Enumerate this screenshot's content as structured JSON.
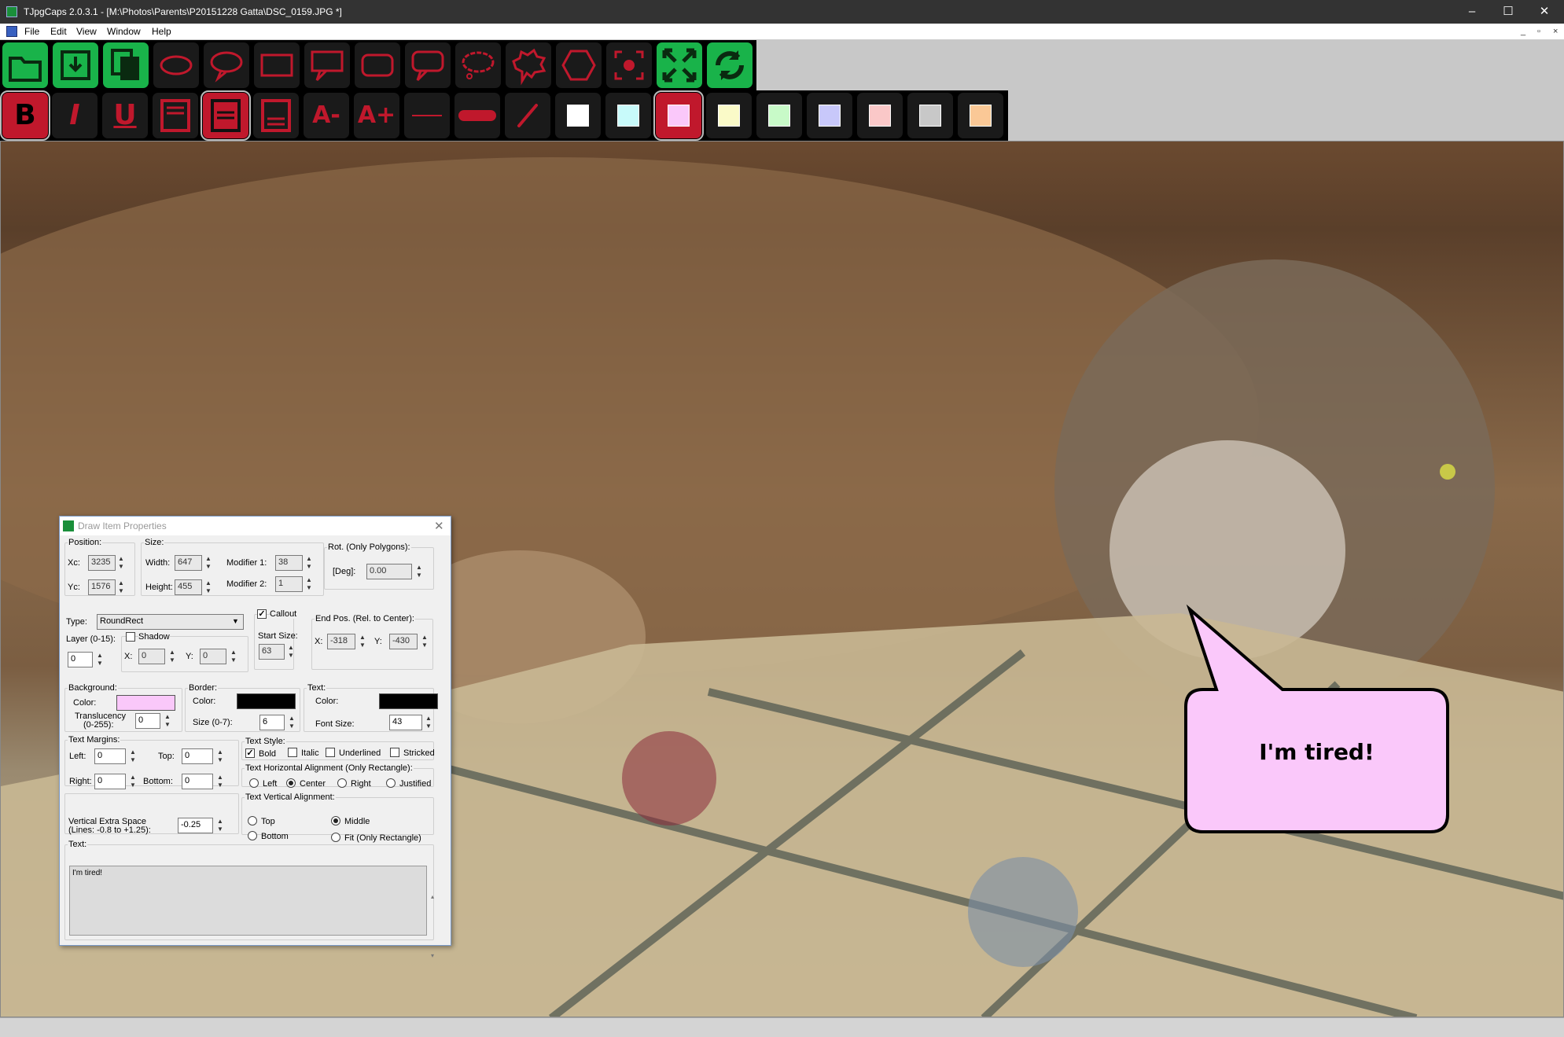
{
  "window": {
    "title": "TJpgCaps 2.0.3.1 - [M:\\Photos\\Parents\\P20151228 Gatta\\DSC_0159.JPG *]",
    "minimize": "–",
    "maximize": "☐",
    "close": "✕"
  },
  "menu": [
    "File",
    "Edit",
    "View",
    "Window",
    "Help"
  ],
  "mdi_controls": [
    "_",
    "▫",
    "×"
  ],
  "toolbar1": [
    {
      "icon": "open-folder-icon",
      "color": "#19b34a"
    },
    {
      "icon": "save-icon",
      "color": "#19b34a"
    },
    {
      "icon": "copy-icon",
      "color": "#19b34a"
    },
    {
      "icon": "ellipse-icon",
      "color": "#c0182c"
    },
    {
      "icon": "ellipse-callout-icon",
      "color": "#c0182c"
    },
    {
      "icon": "rectangle-icon",
      "color": "#c0182c"
    },
    {
      "icon": "rect-callout-icon",
      "color": "#c0182c"
    },
    {
      "icon": "roundrect-icon",
      "color": "#c0182c"
    },
    {
      "icon": "roundrect-callout-icon",
      "color": "#c0182c"
    },
    {
      "icon": "cloud-callout-icon",
      "color": "#c0182c"
    },
    {
      "icon": "spiky-callout-icon",
      "color": "#c0182c"
    },
    {
      "icon": "hexagon-icon",
      "color": "#c0182c"
    },
    {
      "icon": "focus-icon",
      "color": "#c0182c"
    },
    {
      "icon": "fit-screen-icon",
      "color": "#19b34a"
    },
    {
      "icon": "refresh-icon",
      "color": "#19b34a"
    }
  ],
  "toolbar2": {
    "style_buttons": [
      {
        "label": "B",
        "icon": "bold-icon"
      },
      {
        "label": "I",
        "icon": "italic-icon"
      },
      {
        "label": "U",
        "icon": "underline-icon"
      }
    ],
    "align_icons": [
      "align-top-icon",
      "align-middle-icon",
      "align-bottom-icon"
    ],
    "font_minus": "A-",
    "font_plus": "A+",
    "line_icons": [
      "thin-line-icon",
      "thick-line-icon",
      "pen-icon"
    ],
    "swatches": [
      "#ffffff",
      "#c8fafa",
      "#fac8fa",
      "#fafac8",
      "#c8fac8",
      "#c8c8fa",
      "#fac8c8",
      "#c8c8c8",
      "#fac896"
    ],
    "selected_swatch": 2
  },
  "callout": {
    "text": "I'm tired!",
    "bg": "#fac8fa"
  },
  "dialog": {
    "title": "Draw Item Properties",
    "position": {
      "legend": "Position:",
      "xc_label": "Xc:",
      "xc": "3235",
      "yc_label": "Yc:",
      "yc": "1576"
    },
    "size": {
      "legend": "Size:",
      "width_label": "Width:",
      "width": "647",
      "height_label": "Height:",
      "height": "455",
      "mod1_label": "Modifier 1:",
      "mod1": "38",
      "mod2_label": "Modifier 2:",
      "mod2": "1"
    },
    "rot": {
      "legend": "Rot. (Only Polygons):",
      "deg_label": "[Deg]:",
      "deg": "0.00"
    },
    "type_label": "Type:",
    "type": "RoundRect",
    "layer_label": "Layer (0-15):",
    "layer": "0",
    "shadow": {
      "label": "Shadow",
      "x_label": "X:",
      "x": "0",
      "y_label": "Y:",
      "y": "0"
    },
    "callout": {
      "label": "Callout",
      "start_label": "Start Size:",
      "start": "63"
    },
    "endpos": {
      "legend": "End Pos. (Rel. to Center):",
      "x_label": "X:",
      "x": "-318",
      "y_label": "Y:",
      "y": "-430"
    },
    "background": {
      "legend": "Background:",
      "color_label": "Color:",
      "color": "#fac8fa",
      "trans_label1": "Translucency",
      "trans_label2": "(0-255):",
      "trans": "0"
    },
    "border": {
      "legend": "Border:",
      "color_label": "Color:",
      "color": "#000000",
      "size_label": "Size (0-7):",
      "size": "6"
    },
    "text": {
      "legend": "Text:",
      "color_label": "Color:",
      "color": "#000000",
      "fontsize_label": "Font Size:",
      "fontsize": "43"
    },
    "margins": {
      "legend": "Text Margins:",
      "left_label": "Left:",
      "left": "0",
      "top_label": "Top:",
      "top": "0",
      "right_label": "Right:",
      "right": "0",
      "bottom_label": "Bottom:",
      "bottom": "0"
    },
    "style": {
      "legend": "Text Style:",
      "bold": "Bold",
      "italic": "Italic",
      "underlined": "Underlined",
      "stricked": "Stricked"
    },
    "halign": {
      "legend": "Text Horizontal Alignment (Only Rectangle):",
      "left": "Left",
      "center": "Center",
      "right": "Right",
      "justified": "Justified"
    },
    "vspace": {
      "label1": "Vertical Extra Space",
      "label2": "(Lines: -0.8 to +1.25):",
      "value": "-0.25"
    },
    "valign": {
      "legend": "Text Vertical Alignment:",
      "top": "Top",
      "bottom": "Bottom",
      "middle": "Middle",
      "fit": "Fit (Only Rectangle)"
    },
    "textbox": {
      "legend": "Text:",
      "value": "I'm tired!"
    }
  }
}
